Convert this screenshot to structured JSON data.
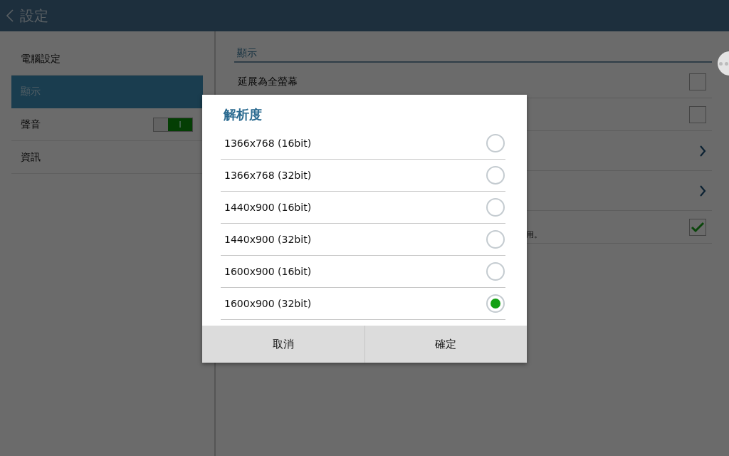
{
  "header": {
    "title": "設定"
  },
  "sidebar": {
    "items": [
      {
        "label": "電腦設定",
        "selected": false
      },
      {
        "label": "顯示",
        "selected": true
      },
      {
        "label": "聲音",
        "selected": false,
        "toggle": {
          "on": true,
          "label": "I"
        }
      },
      {
        "label": "資訊",
        "selected": false
      }
    ]
  },
  "section": {
    "title": "顯示",
    "rows": [
      {
        "kind": "checkbox",
        "label": "延展為全螢幕",
        "checked": false
      },
      {
        "kind": "checkbox",
        "checked": false
      },
      {
        "kind": "link"
      },
      {
        "kind": "link"
      },
      {
        "kind": "checkbox",
        "note": "用。",
        "checked": true
      }
    ]
  },
  "dialog": {
    "title": "解析度",
    "options": [
      {
        "label": "1366x768 (16bit)",
        "selected": false
      },
      {
        "label": "1366x768 (32bit)",
        "selected": false
      },
      {
        "label": "1440x900 (16bit)",
        "selected": false
      },
      {
        "label": "1440x900 (32bit)",
        "selected": false
      },
      {
        "label": "1600x900 (16bit)",
        "selected": false
      },
      {
        "label": "1600x900 (32bit)",
        "selected": true
      }
    ],
    "buttons": [
      "取消",
      "確定"
    ]
  }
}
